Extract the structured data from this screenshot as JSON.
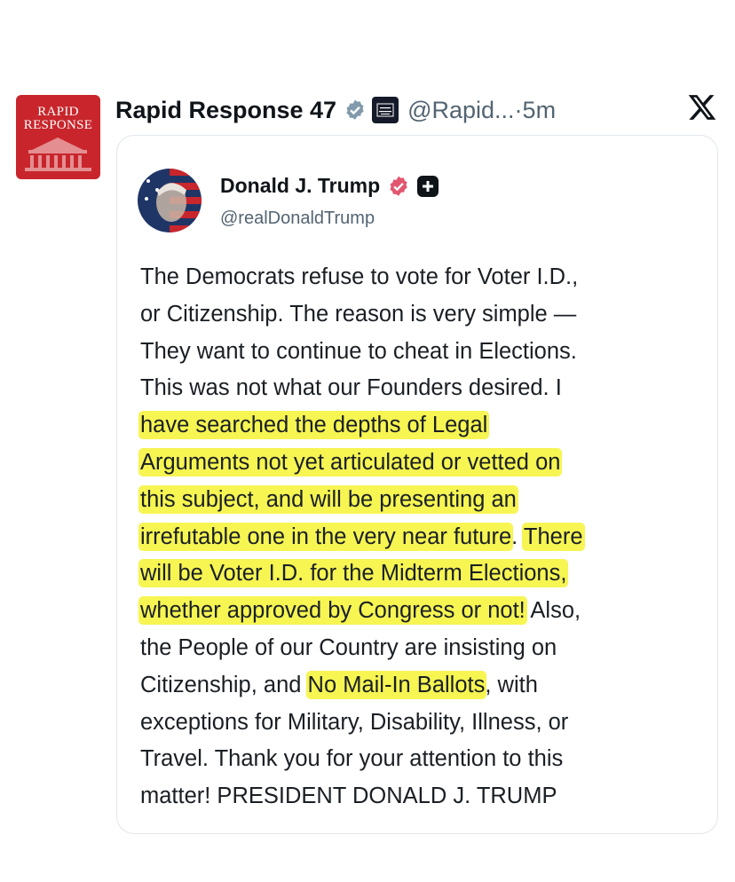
{
  "repost": {
    "account_name": "Rapid Response 47",
    "handle": "@Rapid...",
    "separator": "·",
    "time": "5m",
    "avatar_logo_text": [
      "RAPID",
      "RESPONSE"
    ],
    "verified_icon": "verified-badge-gray-icon",
    "affiliate_badge_icon": "white-house-icon",
    "platform_icon": "x-logo-icon"
  },
  "quoted_post": {
    "author_name": "Donald J. Trump",
    "author_handle": "@realDonaldTrump",
    "verified_icon": "verified-badge-pink-icon",
    "platform_icon": "truth-social-plus-icon",
    "lines": [
      [
        {
          "t": "The Democrats refuse to vote for Voter I.D.,",
          "h": false
        }
      ],
      [
        {
          "t": "or Citizenship. The reason is very simple —",
          "h": false
        }
      ],
      [
        {
          "t": "They want to continue to cheat in Elections.",
          "h": false
        }
      ],
      [
        {
          "t": "This was not what our Founders desired. I",
          "h": false
        }
      ],
      [
        {
          "t": "have searched the depths of Legal",
          "h": true
        }
      ],
      [
        {
          "t": "Arguments not yet articulated or vetted on",
          "h": true
        }
      ],
      [
        {
          "t": "this subject, and will be presenting an",
          "h": true
        }
      ],
      [
        {
          "t": "irrefutable one in the very near future",
          "h": true
        },
        {
          "t": ". ",
          "h": false
        },
        {
          "t": "There",
          "h": true
        }
      ],
      [
        {
          "t": "will be Voter I.D. for the Midterm Elections,",
          "h": true
        }
      ],
      [
        {
          "t": "whether approved by Congress or not!",
          "h": true
        },
        {
          "t": " Also,",
          "h": false
        }
      ],
      [
        {
          "t": "the People of our Country are insisting on",
          "h": false
        }
      ],
      [
        {
          "t": "Citizenship, and ",
          "h": false
        },
        {
          "t": "No Mail-In Ballots",
          "h": true
        },
        {
          "t": ", with",
          "h": false
        }
      ],
      [
        {
          "t": "exceptions for Military, Disability, Illness, or",
          "h": false
        }
      ],
      [
        {
          "t": "Travel. Thank you for your attention to this",
          "h": false
        }
      ],
      [
        {
          "t": "matter! PRESIDENT DONALD J. TRUMP",
          "h": false
        }
      ]
    ],
    "highlight_color": "#f6f552"
  }
}
